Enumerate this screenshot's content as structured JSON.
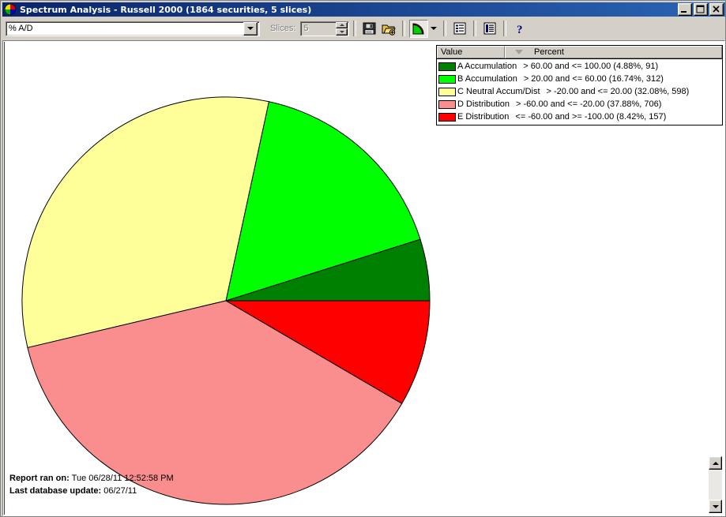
{
  "window": {
    "title": "Spectrum Analysis - Russell 2000 (1864 securities, 5 slices)",
    "icon": "spectrum-app-icon",
    "minimize_label": "_",
    "maximize_label": "□",
    "close_label": "×"
  },
  "toolbar": {
    "indicator_value": "% A/D",
    "indicator_dropdown_icon": "chevron-down-icon",
    "slices_label": "Slices:",
    "slices_value": "5",
    "buttons": [
      {
        "name": "save-button",
        "icon": "floppy-disk-icon",
        "label": "Save"
      },
      {
        "name": "open-button",
        "icon": "open-folder-add-icon",
        "label": "Open"
      },
      {
        "name": "chart-type-button",
        "icon": "pie-chart-icon",
        "label": "Chart Type"
      },
      {
        "name": "chart-type-dropdown",
        "icon": "chevron-down-icon",
        "label": "Chart Options"
      },
      {
        "name": "report-view-button",
        "icon": "list-report-icon",
        "label": "Report View"
      },
      {
        "name": "detail-view-button",
        "icon": "detail-list-icon",
        "label": "Detail View"
      },
      {
        "name": "help-button",
        "icon": "question-mark-icon",
        "label": "Help"
      }
    ]
  },
  "legend": {
    "columns": [
      "Value",
      "Percent"
    ],
    "sort_indicator_icon": "sort-descending-icon",
    "rows": [
      {
        "color": "#008000",
        "label": "A Accumulation",
        "range": "> 60.00 and <= 100.00 (4.88%, 91)"
      },
      {
        "color": "#00ff00",
        "label": "B Accumulation",
        "range": "> 20.00 and <= 60.00 (16.74%, 312)"
      },
      {
        "color": "#ffff99",
        "label": "C Neutral Accum/Dist",
        "range": "> -20.00 and <= 20.00 (32.08%, 598)"
      },
      {
        "color": "#fa8d8d",
        "label": "D Distribution",
        "range": "> -60.00 and <= -20.00 (37.88%, 706)"
      },
      {
        "color": "#ff0000",
        "label": "E Distribution",
        "range": "<= -60.00 and >= -100.00 (8.42%, 157)"
      }
    ]
  },
  "footer": {
    "report_ran_label": "Report ran on:",
    "report_ran_value": "Tue 06/28/11 12:52:58 PM",
    "db_update_label": "Last database update:",
    "db_update_value": "06/27/11"
  },
  "scrollbar": {
    "up_icon": "scroll-up-arrow-icon",
    "down_icon": "scroll-down-arrow-icon"
  },
  "chart_data": {
    "type": "pie",
    "title": "Spectrum Analysis - Russell 2000",
    "subtitle": "1864 securities, 5 slices",
    "indicator": "% A/D",
    "total_securities": 1864,
    "slice_count": 5,
    "start_angle_deg": 0,
    "direction": "counterclockwise",
    "center": [
      280,
      328
    ],
    "radius": 258,
    "categories": [
      "A Accumulation",
      "B Accumulation",
      "C Neutral Accum/Dist",
      "D Distribution",
      "E Distribution"
    ],
    "values": [
      4.88,
      16.74,
      32.08,
      37.88,
      8.42
    ],
    "counts": [
      91,
      312,
      598,
      706,
      157
    ],
    "ranges": [
      "> 60.00 and <= 100.00",
      "> 20.00 and <= 60.00",
      "> -20.00 and <= 20.00",
      "> -60.00 and <= -20.00",
      "<= -60.00 and >= -100.00"
    ],
    "colors": [
      "#008000",
      "#00ff00",
      "#ffff99",
      "#fa8d8d",
      "#ff0000"
    ],
    "stroke": "#000000",
    "legend_position": "top-right",
    "grid": false,
    "xlabel": "",
    "ylabel": ""
  }
}
